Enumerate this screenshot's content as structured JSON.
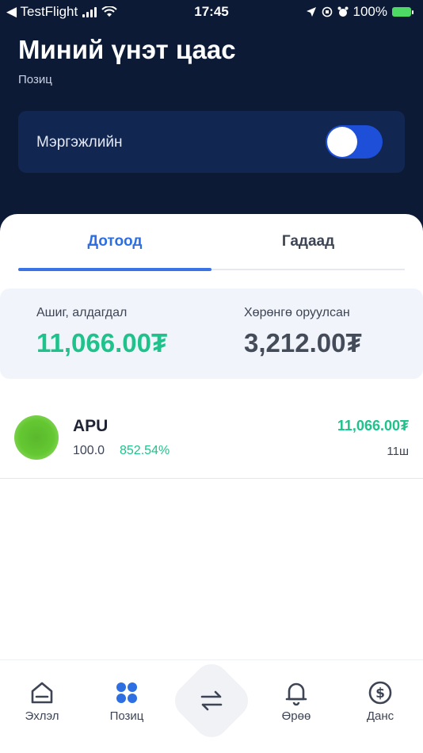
{
  "status_bar": {
    "back_app": "◀ TestFlight",
    "time": "17:45",
    "battery": "100%"
  },
  "header": {
    "title": "Миний үнэт цаас",
    "subtitle": "Позиц"
  },
  "pro_toggle": {
    "label": "Мэргэжлийн",
    "state": "off"
  },
  "tabs": [
    {
      "label": "Дотоод",
      "active": true
    },
    {
      "label": "Гадаад",
      "active": false
    }
  ],
  "summary": {
    "profit_loss_caption": "Ашиг, алдагдал",
    "profit_loss_value": "11,066.00₮",
    "invested_caption": "Хөрөнгө оруулсан",
    "invested_value": "3,212.00₮"
  },
  "holdings": [
    {
      "symbol": "APU",
      "price": "100.0",
      "change_pct": "852.54%",
      "value": "11,066.00₮",
      "count": "11ш"
    }
  ],
  "bottom_nav": {
    "items": [
      {
        "label": "Эхлэл",
        "icon": "home-icon"
      },
      {
        "label": "Позиц",
        "icon": "grid-dots-icon"
      },
      {
        "label": "",
        "icon": "swap-arrows-icon"
      },
      {
        "label": "Өрөө",
        "icon": "bell-icon"
      },
      {
        "label": "Данс",
        "icon": "dollar-circle-icon"
      }
    ]
  },
  "colors": {
    "header_bg": "#0c1a36",
    "accent_blue": "#2d6fe3",
    "positive_green": "#1ec28a"
  }
}
